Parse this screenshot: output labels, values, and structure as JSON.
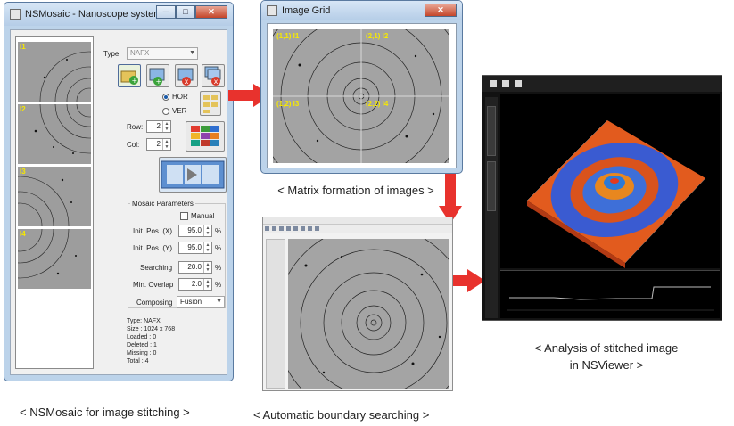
{
  "mosaic_window": {
    "title": "NSMosaic - Nanoscope systems",
    "type_label": "Type:",
    "type_value": "NAFX",
    "orientation_options": [
      "HOR",
      "VER"
    ],
    "orientation_selected": "HOR",
    "row_label": "Row:",
    "row_value": "2",
    "col_label": "Col:",
    "col_value": "2",
    "thumbnails": [
      "I1",
      "I2",
      "I3",
      "I4"
    ],
    "params_group_title": "Mosaic Parameters",
    "manual_label": "Manual",
    "params": [
      {
        "label": "Init. Pos. (X)",
        "value": "95.0",
        "unit": "%"
      },
      {
        "label": "Init. Pos. (Y)",
        "value": "95.0",
        "unit": "%"
      },
      {
        "label": "Searching",
        "value": "20.0",
        "unit": "%"
      },
      {
        "label": "Min. Overlap",
        "value": "2.0",
        "unit": "%"
      }
    ],
    "composing_label": "Composing",
    "composing_value": "Fusion",
    "status": {
      "type": "Type: NAFX",
      "size": "Size : 1024 x 768",
      "loaded": "Loaded : 0",
      "deleted": "Deleted : 1",
      "missing": "Missing : 0",
      "total": "Total : 4"
    }
  },
  "grid_window": {
    "title": "Image Grid",
    "cells": [
      "(1,1) I1",
      "(2,1) I2",
      "(1,2) I3",
      "(2,2) I4"
    ]
  },
  "captions": {
    "mosaic": "< NSMosaic for image stitching >",
    "grid": "< Matrix formation of images >",
    "boundary": "< Automatic boundary searching >",
    "viewer_line1": "< Analysis of stitched image",
    "viewer_line2": "in NSViewer >"
  },
  "colors": {
    "arrow": "#e8322d",
    "thumb_label": "#f7e900",
    "window_frame": "#bcd3ea"
  }
}
